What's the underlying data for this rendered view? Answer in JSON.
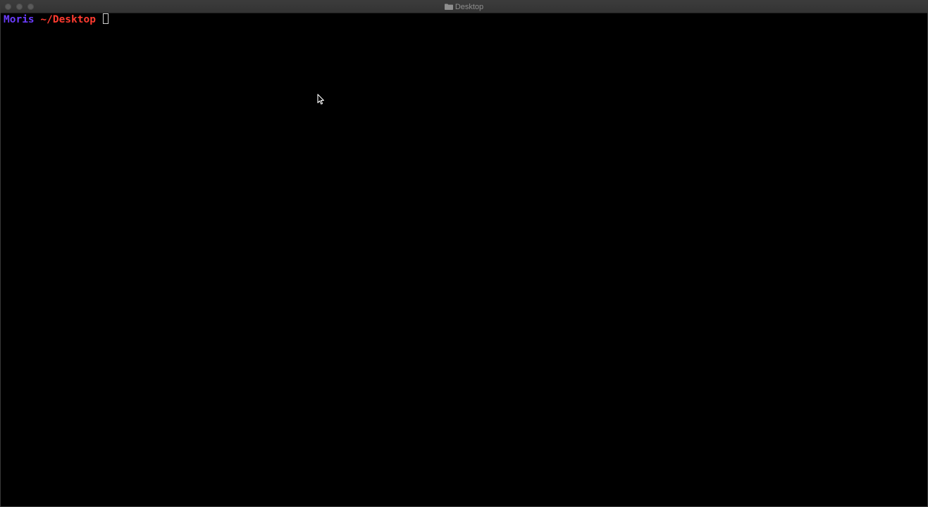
{
  "window": {
    "title": "Desktop",
    "title_icon": "folder-icon"
  },
  "terminal": {
    "prompt": {
      "user": "Moris",
      "cwd": "~/Desktop",
      "separator": " ",
      "user_color": "#6b3cff",
      "cwd_color": "#ff3b30"
    },
    "background_color": "#000000"
  },
  "pointer": {
    "icon": "arrow-pointer-icon"
  }
}
